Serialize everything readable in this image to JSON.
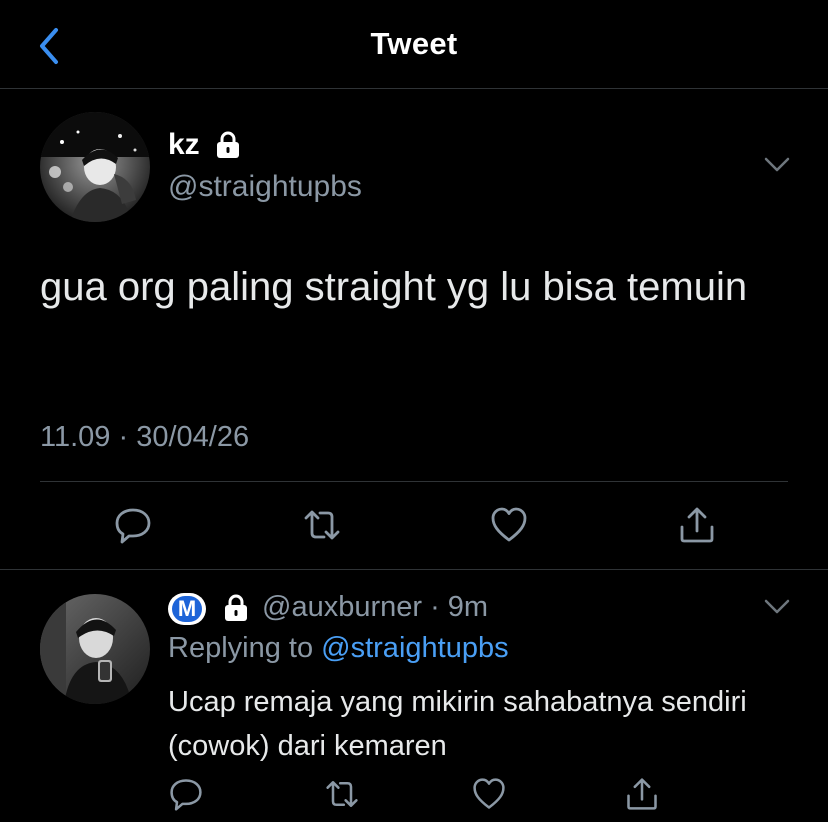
{
  "header": {
    "title": "Tweet",
    "back_icon": "chevron-left-icon",
    "accent_color": "#3a8ef0"
  },
  "tweet": {
    "author_name": "kz",
    "author_handle": "@straightupbs",
    "text": "gua org paling straight yg lu bisa temuin",
    "meta": "11.09 · 30/04/26",
    "protected_icon": "lock-icon",
    "more_icon": "chevron-down-icon",
    "actions": [
      "reply-icon",
      "retweet-icon",
      "like-icon",
      "share-icon"
    ]
  },
  "reply": {
    "badge_letter": "M",
    "handle_time": "@auxburner · 9m",
    "replying_prefix": "Replying to ",
    "replying_to": "@straightupbs",
    "text": "Ucap remaja yang mikirin sahabatnya sendiri (cowok) dari kemaren",
    "badge_color": "#1d64d8",
    "mention_color": "#4a9ff5",
    "actions": [
      "reply-icon",
      "retweet-icon",
      "like-icon",
      "share-icon"
    ]
  }
}
